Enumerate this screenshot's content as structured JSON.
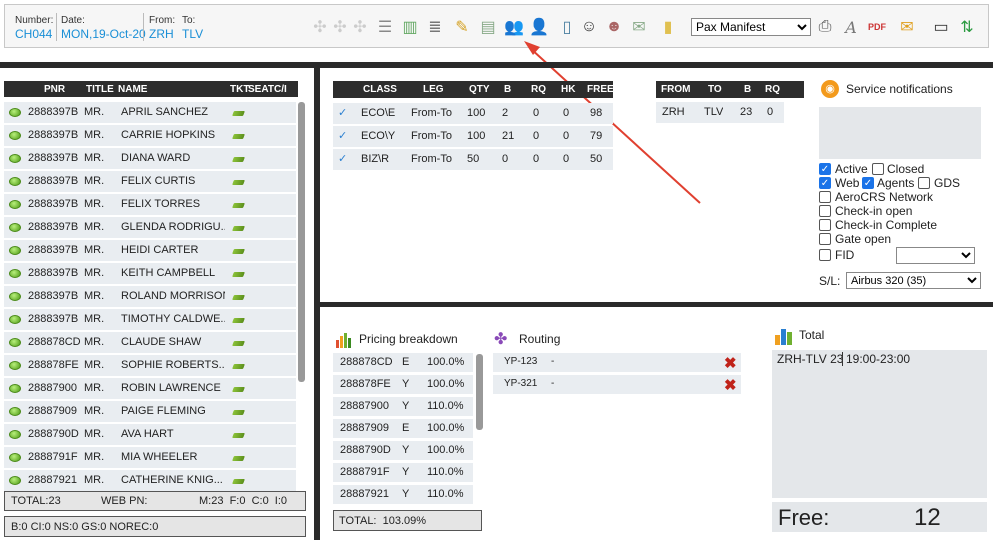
{
  "header": {
    "number_label": "Number:",
    "number": "CH044",
    "date_label": "Date:",
    "date": "MON,19-Oct-20",
    "from_label": "From:",
    "from": "ZRH",
    "to_label": "To:",
    "to": "TLV",
    "report_select": "Pax Manifest"
  },
  "toolbar_icons": [
    "move-icon",
    "move-icon",
    "move-icon",
    "add-row-icon",
    "chart-bars-icon",
    "stack-icon",
    "pencil-icon",
    "edit-doc-icon",
    "users-icon",
    "user-edit-icon",
    "phone-icon",
    "pilot-icon",
    "user-swap-icon",
    "mail-open-icon",
    "folder-icon",
    "printer-icon",
    "text-icon",
    "pdf-icon",
    "envelope-icon",
    "clipboard-icon",
    "refresh-icon"
  ],
  "pax": {
    "columns": [
      "PNR",
      "TITLE",
      "NAME",
      "TKT",
      "SEAT",
      "C/I"
    ],
    "rows": [
      {
        "pnr": "2888397B",
        "title": "MR.",
        "name": "APRIL SANCHEZ"
      },
      {
        "pnr": "2888397B",
        "title": "MR.",
        "name": "CARRIE HOPKINS"
      },
      {
        "pnr": "2888397B",
        "title": "MR.",
        "name": "DIANA WARD"
      },
      {
        "pnr": "2888397B",
        "title": "MR.",
        "name": "FELIX CURTIS"
      },
      {
        "pnr": "2888397B",
        "title": "MR.",
        "name": "FELIX TORRES"
      },
      {
        "pnr": "2888397B",
        "title": "MR.",
        "name": "GLENDA RODRIGU..."
      },
      {
        "pnr": "2888397B",
        "title": "MR.",
        "name": "HEIDI CARTER"
      },
      {
        "pnr": "2888397B",
        "title": "MR.",
        "name": "KEITH CAMPBELL"
      },
      {
        "pnr": "2888397B",
        "title": "MR.",
        "name": "ROLAND MORRISON"
      },
      {
        "pnr": "2888397B",
        "title": "MR.",
        "name": "TIMOTHY CALDWE..."
      },
      {
        "pnr": "288878CD",
        "title": "MR.",
        "name": "CLAUDE SHAW"
      },
      {
        "pnr": "288878FE",
        "title": "MR.",
        "name": "SOPHIE ROBERTS..."
      },
      {
        "pnr": "28887900",
        "title": "MR.",
        "name": "ROBIN LAWRENCE"
      },
      {
        "pnr": "28887909",
        "title": "MR.",
        "name": "PAIGE FLEMING"
      },
      {
        "pnr": "2888790D",
        "title": "MR.",
        "name": "AVA HART"
      },
      {
        "pnr": "2888791F",
        "title": "MR.",
        "name": "MIA WHEELER"
      },
      {
        "pnr": "28887921",
        "title": "MR.",
        "name": "CATHERINE KNIG..."
      }
    ],
    "total": "TOTAL:23",
    "web_pn": "WEB PN:",
    "mix": "M:23  F:0  C:0  I:0",
    "bottom": "B:0 CI:0 NS:0 GS:0 NOREC:0"
  },
  "classes": {
    "columns": [
      "CLASS",
      "LEG",
      "QTY",
      "B",
      "RQ",
      "HK",
      "FREE"
    ],
    "rows": [
      {
        "class": "ECO\\E",
        "leg": "From-To",
        "qty": "100",
        "b": "2",
        "rq": "0",
        "hk": "0",
        "free": "98"
      },
      {
        "class": "ECO\\Y",
        "leg": "From-To",
        "qty": "100",
        "b": "21",
        "rq": "0",
        "hk": "0",
        "free": "79"
      },
      {
        "class": "BIZ\\R",
        "leg": "From-To",
        "qty": "50",
        "b": "0",
        "rq": "0",
        "hk": "0",
        "free": "50"
      }
    ]
  },
  "legs": {
    "columns": [
      "FROM",
      "TO",
      "B",
      "RQ"
    ],
    "rows": [
      {
        "from": "ZRH",
        "to": "TLV",
        "b": "23",
        "rq": "0"
      }
    ]
  },
  "notifications": {
    "title": "Service notifications",
    "active": "Active",
    "closed": "Closed",
    "web": "Web",
    "agents": "Agents",
    "gds": "GDS",
    "aerocrs": "AeroCRS Network",
    "checkin_open": "Check-in open",
    "checkin_complete": "Check-in Complete",
    "gate_open": "Gate open",
    "fid": "FID",
    "sl_label": "S/L:",
    "sl_value": "Airbus 320 (35)"
  },
  "pricing": {
    "title": "Pricing breakdown",
    "rows": [
      {
        "pnr": "288878CD",
        "cls": "E",
        "pct": "100.0%"
      },
      {
        "pnr": "288878FE",
        "cls": "Y",
        "pct": "100.0%"
      },
      {
        "pnr": "28887900",
        "cls": "Y",
        "pct": "110.0%"
      },
      {
        "pnr": "28887909",
        "cls": "E",
        "pct": "100.0%"
      },
      {
        "pnr": "2888790D",
        "cls": "Y",
        "pct": "100.0%"
      },
      {
        "pnr": "2888791F",
        "cls": "Y",
        "pct": "110.0%"
      },
      {
        "pnr": "28887921",
        "cls": "Y",
        "pct": "110.0%"
      }
    ],
    "total": "TOTAL:  103.09%"
  },
  "routing": {
    "title": "Routing",
    "rows": [
      {
        "code": "YP-123",
        "dash": "-"
      },
      {
        "code": "YP-321",
        "dash": "-"
      }
    ]
  },
  "total_panel": {
    "title": "Total",
    "route": "ZRH-TLV 23",
    "time": "19:00-23:00",
    "free_label": "Free:",
    "free_value": "12"
  }
}
